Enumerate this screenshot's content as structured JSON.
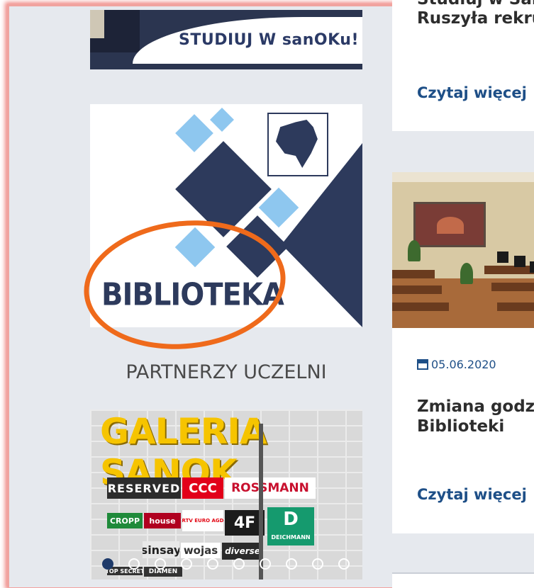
{
  "left_column": {
    "banner_sanok_text": "STUDIUJ W sanOKu!",
    "biblioteka_text": "BIBLIOTEKA",
    "partners_title": "PARTNERZY UCZELNI",
    "galeria_title": "GALERIA SANOK",
    "stores": [
      "RESERVED",
      "CCC",
      "ROSSMANN",
      "CROPP",
      "house",
      "RTV EURO AGD",
      "4F",
      "D",
      "DEICHMANN",
      "sinsay",
      "wojas",
      "diverse",
      "TOP SECRET",
      "DIAMEN"
    ],
    "carousel": {
      "count": 10,
      "active": 0
    }
  },
  "right_column": {
    "card1": {
      "title_lines": [
        "Studiuj w San",
        "Ruszyła rekru"
      ],
      "read_more": "Czytaj więcej"
    },
    "card2": {
      "date": "05.06.2020",
      "title_lines": [
        "Zmiana godzi",
        "Biblioteki"
      ],
      "read_more": "Czytaj więcej"
    }
  },
  "colors": {
    "page_bg": "#e6e9ee",
    "navy": "#2d3a5c",
    "link": "#1e4f87",
    "highlight_circle": "#ef6a1b",
    "galeria_yellow": "#f6c400"
  }
}
